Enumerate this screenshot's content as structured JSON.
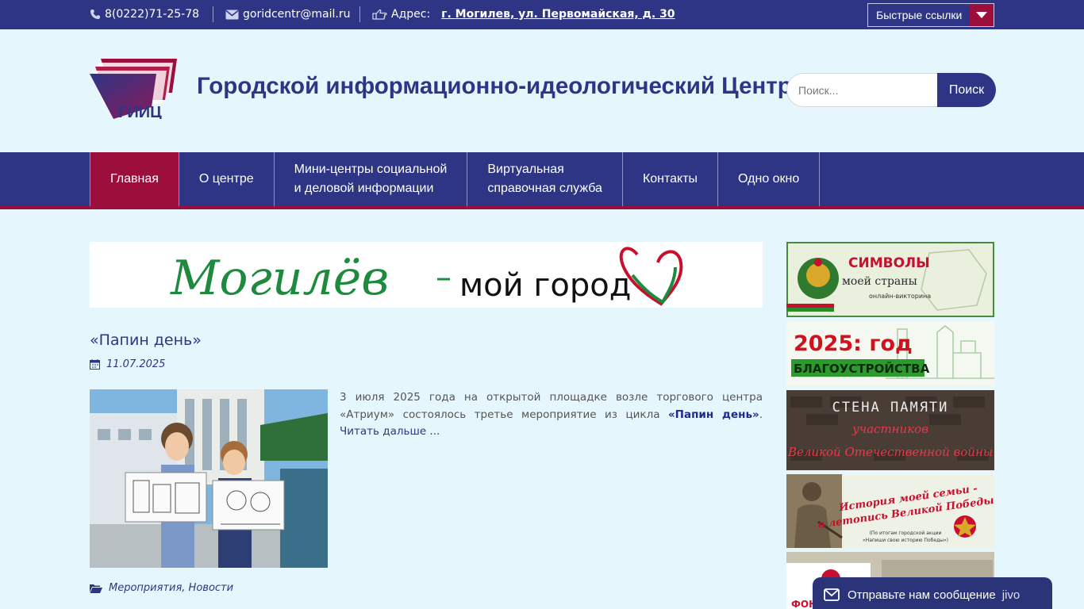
{
  "topbar": {
    "phone": "8(0222)71-25-78",
    "email": "goridcentr@mail.ru",
    "address_label": "Адрес:",
    "address_value": "г. Могилев, ул. Первомайская, д. 30",
    "quick_links": "Быстрые ссылки"
  },
  "header": {
    "logo_text": "ГИИЦ",
    "title": "Городской информационно-идеологический Центр",
    "search_placeholder": "Поиск...",
    "search_button": "Поиск"
  },
  "nav": {
    "items": [
      {
        "label": "Главная"
      },
      {
        "label": "О центре"
      },
      {
        "label": "Мини-центры социальной\nи деловой информации"
      },
      {
        "label": "Виртуальная\nсправочная служба"
      },
      {
        "label": "Контакты"
      },
      {
        "label": "Одно окно"
      }
    ]
  },
  "banner": {
    "script_text": "Могилёв",
    "dash": "–",
    "rest_text": "мой город"
  },
  "post": {
    "title": "«Папин день»",
    "date": "11.07.2025",
    "excerpt_lead": "3 июля 2025 года на открытой площадке возле торгового центра «Атриум» состоялось третье мероприятие из цикла ",
    "excerpt_strong": "«Папин день»",
    "excerpt_tail": ". ",
    "read_more": "Читать дальше ...",
    "categories": "Мероприятия, Новости"
  },
  "sidebar": {
    "b1_title": "СИМВОЛЫ",
    "b1_sub": "моей страны",
    "b1_small": "онлайн-викторина",
    "b2_title": "2025: год",
    "b2_sub": "БЛАГОУСТРОЙСТВА",
    "b3_title": "СТЕНА ПАМЯТИ",
    "b3_line1": "участников",
    "b3_line2": "Великой Отечественной войны",
    "b4_line1": "История моей семьи -",
    "b4_line2": "в летопись Великой Победы!",
    "b4_note1": "(По итогам городской акции",
    "b4_note2": "«Напиши свою историю Победы»)",
    "b5_text": "ФОНД"
  },
  "chat": {
    "label": "Отправьте нам сообщение",
    "brand": "jivo"
  },
  "colors": {
    "primary": "#2e3585",
    "accent": "#9c0f3c",
    "background": "#e6f6fd"
  }
}
